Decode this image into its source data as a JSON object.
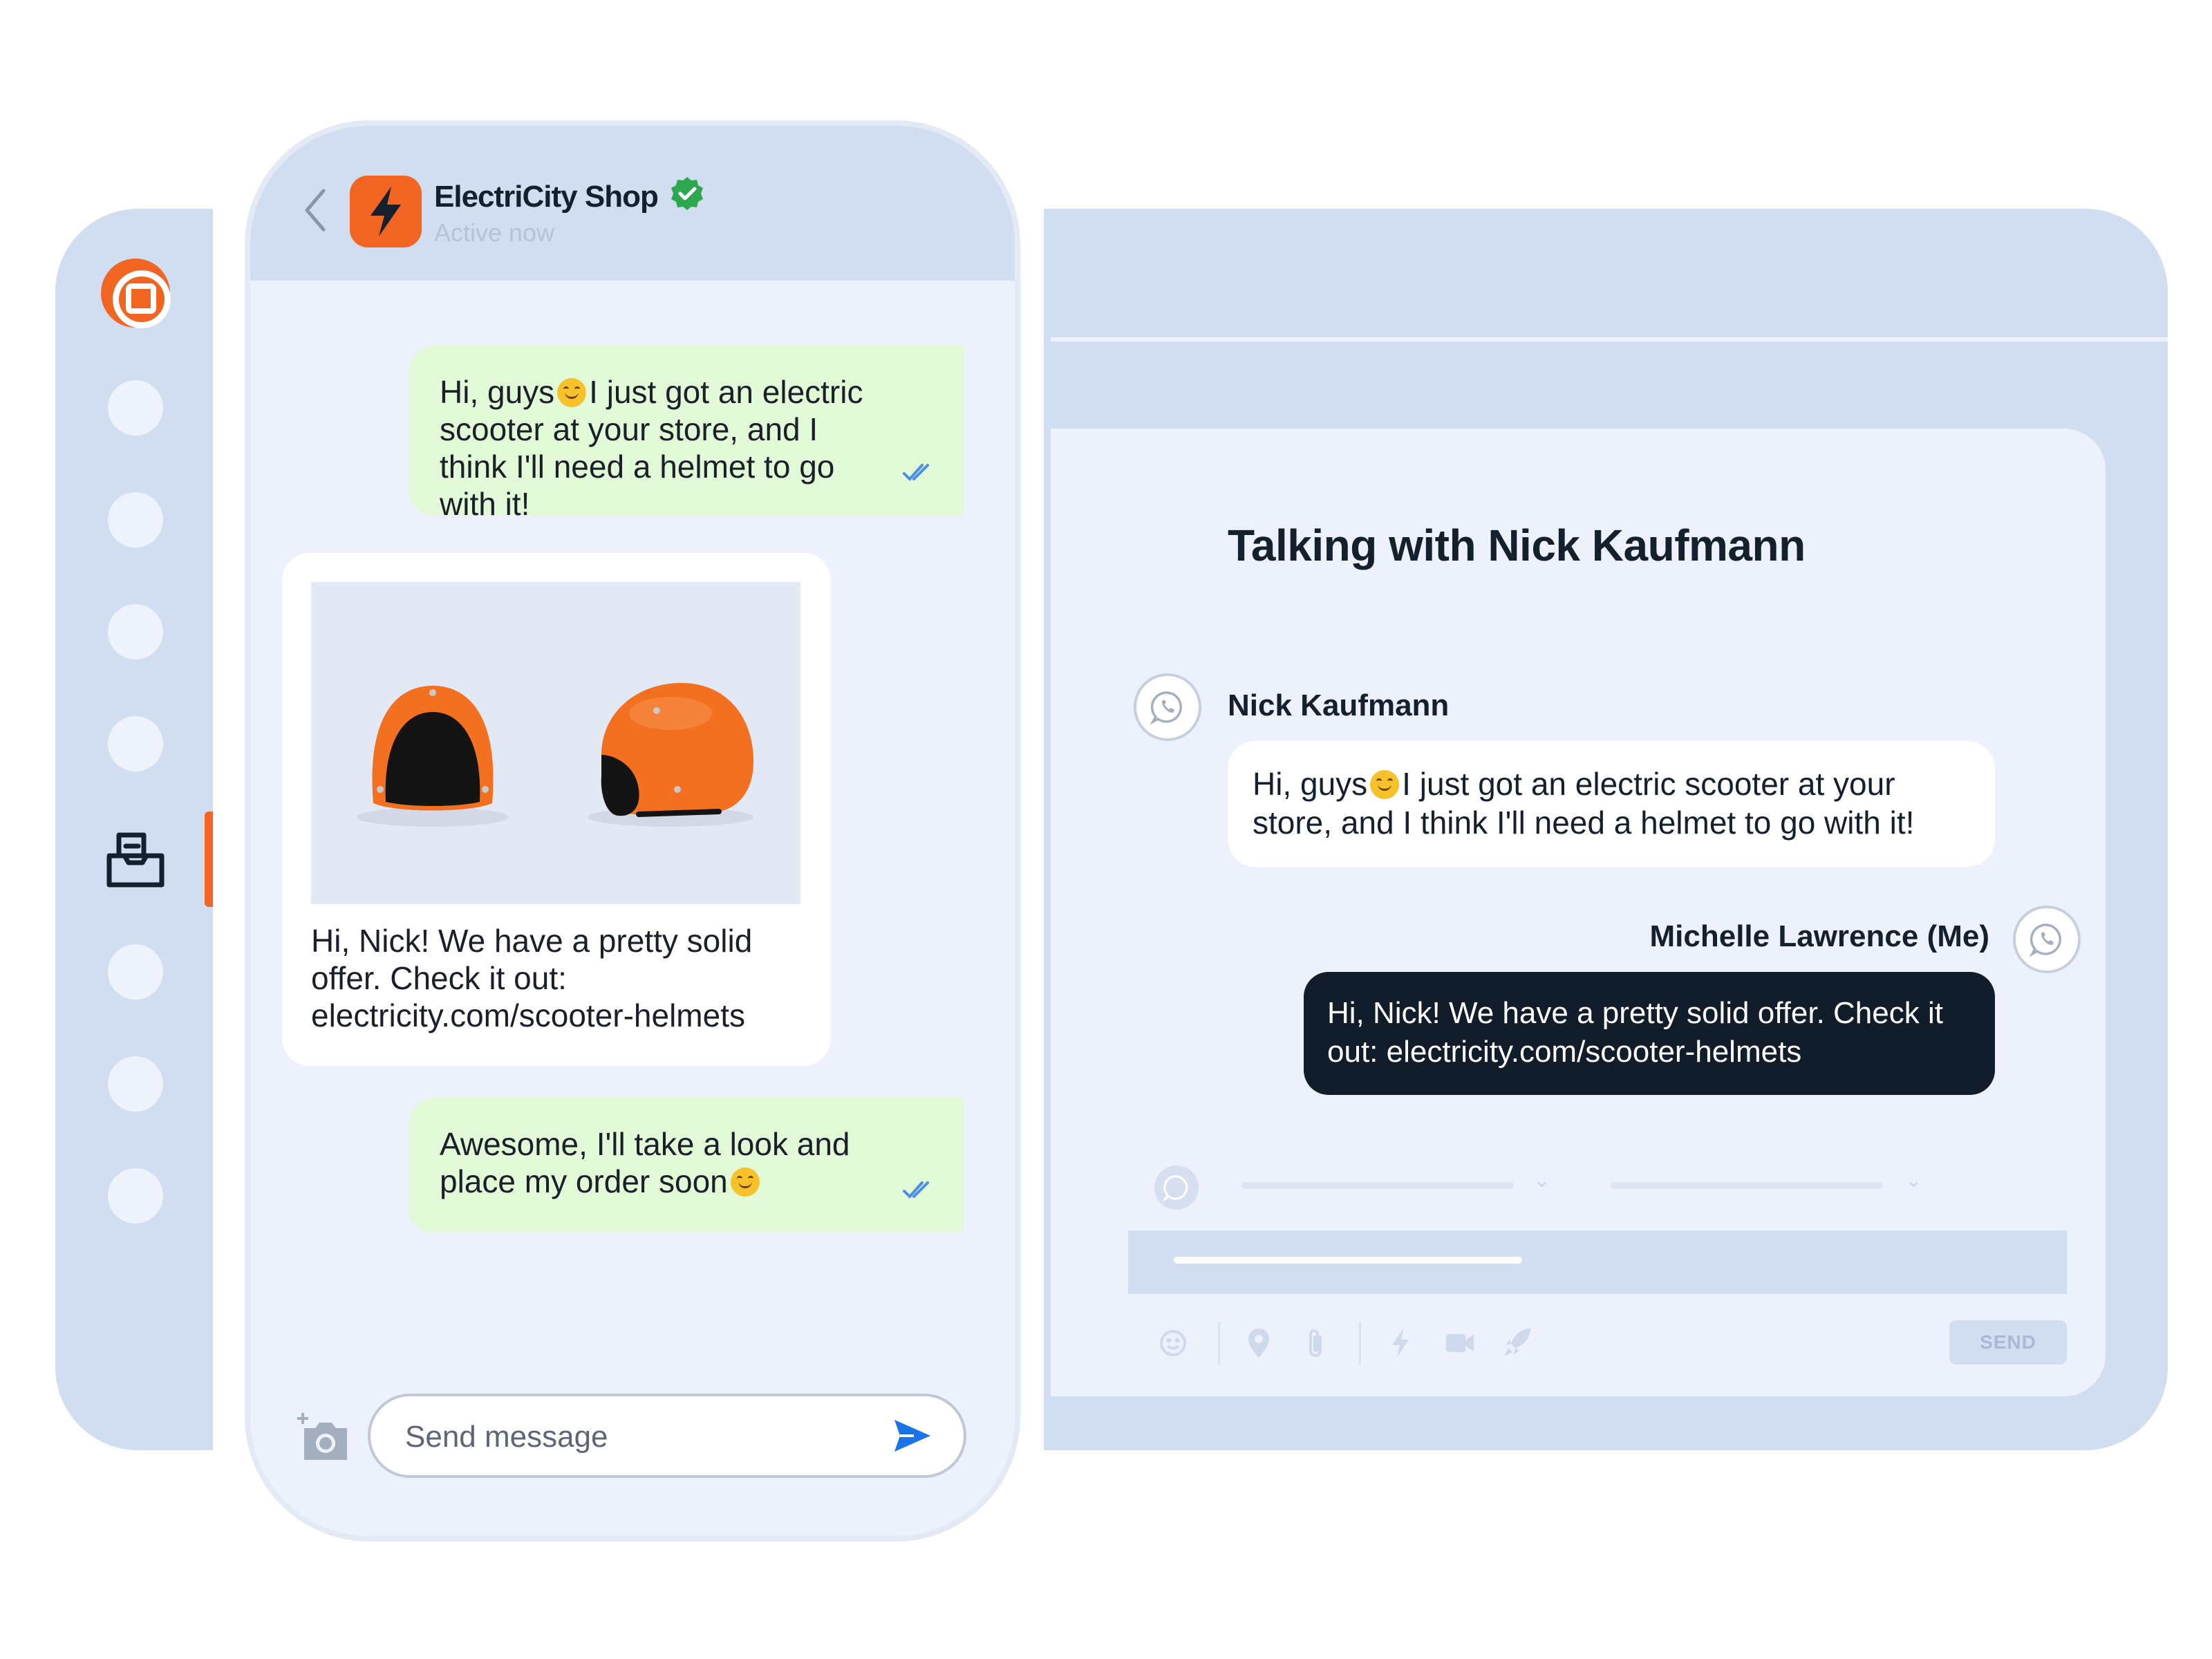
{
  "sidebar": {
    "nav_items": [
      "nav-item-1",
      "nav-item-2",
      "nav-item-3",
      "nav-item-4",
      "nav-item-inbox",
      "nav-item-6",
      "nav-item-7",
      "nav-item-8"
    ],
    "active_item": "inbox"
  },
  "phone": {
    "shop_name": "ElectriCity Shop",
    "shop_status": "Active now",
    "messages": [
      {
        "direction": "outgoing",
        "text_before_emoji": "Hi, guys",
        "text_after_emoji": "I just got an electric scooter at your store, and I think I'll need a helmet to go with it!",
        "status": "read"
      },
      {
        "direction": "incoming",
        "has_image": true,
        "image_description": "two orange helmets",
        "text": "Hi, Nick! We have a pretty solid offer. Check it out: electricity.com/scooter-helmets"
      },
      {
        "direction": "outgoing",
        "text_before_emoji": "Awesome, I'll take a look and place my order soon",
        "text_after_emoji": "",
        "status": "read"
      }
    ],
    "input_placeholder": "Send message"
  },
  "conversation": {
    "title": "Talking with Nick Kaufmann",
    "messages": [
      {
        "author": "Nick Kaufmann",
        "channel": "whatsapp",
        "text_before_emoji": "Hi, guys",
        "text_after_emoji": "I just got an electric scooter at your store, and I think I'll need a helmet to go with it!"
      },
      {
        "author": "Michelle Lawrence (Me)",
        "channel": "whatsapp",
        "text": "Hi, Nick! We have a pretty solid offer. Check it out:  electricity.com/scooter-helmets"
      }
    ],
    "toolbar_icons": [
      "emoji-icon",
      "location-pin-icon",
      "paperclip-icon",
      "lightning-icon",
      "video-camera-icon",
      "rocket-icon"
    ],
    "send_label": "SEND"
  },
  "colors": {
    "brand_orange": "#f26422",
    "panel_blue": "#d1ddf1",
    "panel_light": "#edf1fb",
    "outgoing_bubble": "#e1f9d6",
    "agent_bubble": "#121d2c",
    "verified_green": "#2ea84f",
    "accent_blue": "#1a73e8"
  }
}
